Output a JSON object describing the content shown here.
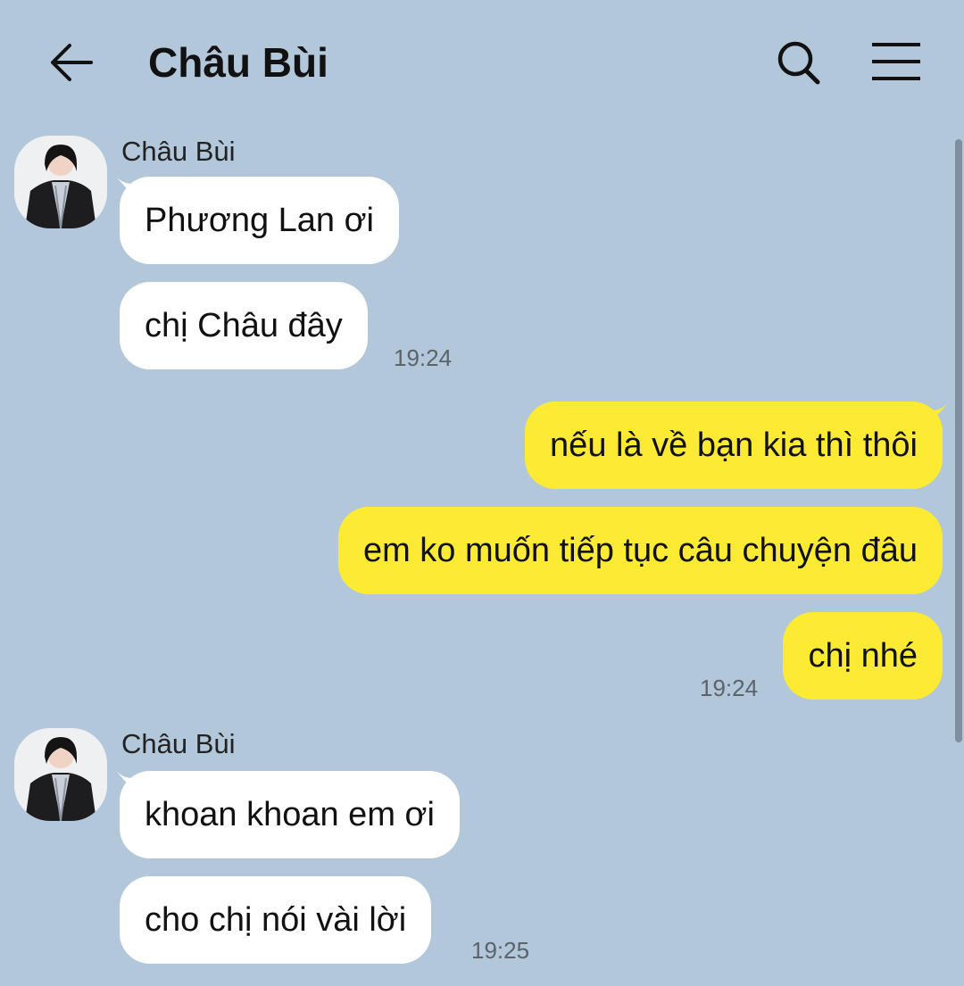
{
  "header": {
    "title": "Châu Bùi"
  },
  "messages": {
    "group1": {
      "sender": "Châu Bùi",
      "bubbles": [
        "Phương Lan ơi",
        "chị Châu đây"
      ],
      "time": "19:24"
    },
    "group2": {
      "bubbles": [
        "nếu là về bạn kia thì thôi",
        "em ko muốn tiếp tục câu chuyện đâu",
        "chị nhé"
      ],
      "time": "19:24"
    },
    "group3": {
      "sender": "Châu Bùi",
      "bubbles": [
        "khoan khoan em ơi",
        "cho chị nói vài lời"
      ],
      "time": "19:25"
    }
  },
  "colors": {
    "background": "#b2c7da",
    "incoming_bubble": "#ffffff",
    "outgoing_bubble": "#fdea33"
  },
  "icons": [
    "back-arrow-icon",
    "search-icon",
    "menu-icon"
  ]
}
